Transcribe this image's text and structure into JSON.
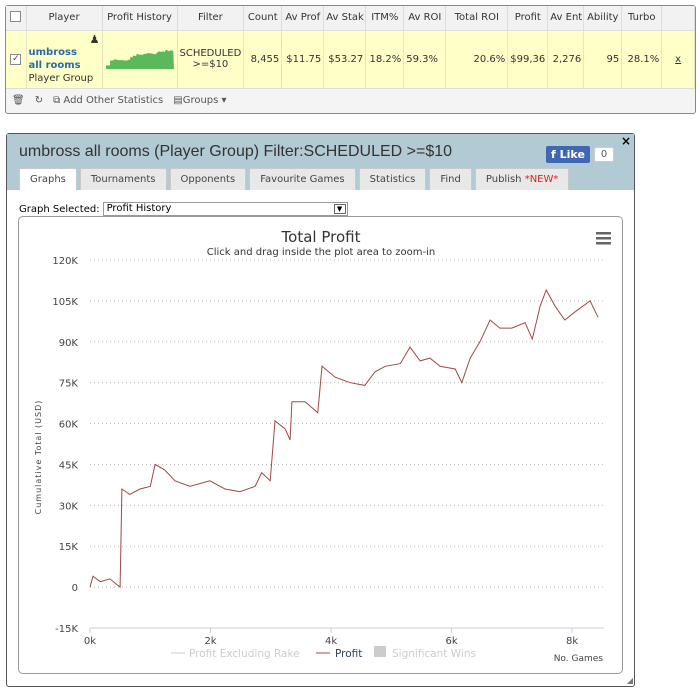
{
  "table": {
    "headers": [
      "Player",
      "Profit History",
      "Filter",
      "Count",
      "Av Prof",
      "Av Stak",
      "ITM%",
      "Av ROI",
      "Total ROI",
      "Profit",
      "Av Ent",
      "Ability",
      "Turbo"
    ],
    "row": {
      "checked": true,
      "player_name": "umbross all rooms",
      "player_sub": "Player Group",
      "filter": "SCHEDULED >=$10",
      "count": "8,455",
      "av_profit": "$11.75",
      "av_stake": "$53.27",
      "itm": "18.2%",
      "av_roi": "59.3%",
      "total_roi": "20.6%",
      "profit": "$99,36",
      "av_entrants": "2,276",
      "ability": "95",
      "turbo": "28.1%",
      "remove": "x"
    },
    "footer": {
      "add_stats": "Add Other Statistics",
      "groups": "Groups"
    }
  },
  "panel": {
    "title": "umbross all rooms (Player Group) Filter:SCHEDULED >=$10",
    "like_label": "Like",
    "like_count": "0",
    "close": "×",
    "tabs": [
      {
        "label": "Graphs",
        "active": true
      },
      {
        "label": "Tournaments"
      },
      {
        "label": "Opponents"
      },
      {
        "label": "Favourite Games"
      },
      {
        "label": "Statistics"
      },
      {
        "label": "Find"
      },
      {
        "label": "Publish ",
        "badge": "*NEW*"
      }
    ],
    "graph_selected_label": "Graph Selected:",
    "graph_selected_value": "Profit History"
  },
  "chart_data": {
    "type": "line",
    "title": "Total Profit",
    "subtitle": "Click and drag inside the plot area to zoom-in",
    "xlabel": "No. Games",
    "ylabel": "Cumulative Total (USD)",
    "xlim": [
      0,
      8530
    ],
    "ylim": [
      -15000,
      120000
    ],
    "xticks": [
      {
        "v": 0,
        "label": "0k"
      },
      {
        "v": 2000,
        "label": "2k"
      },
      {
        "v": 4000,
        "label": "4k"
      },
      {
        "v": 6000,
        "label": "6k"
      },
      {
        "v": 8000,
        "label": "8k"
      }
    ],
    "yticks": [
      {
        "v": -15000,
        "label": "-15K"
      },
      {
        "v": 0,
        "label": "0"
      },
      {
        "v": 15000,
        "label": "15K"
      },
      {
        "v": 30000,
        "label": "30K"
      },
      {
        "v": 45000,
        "label": "45K"
      },
      {
        "v": 60000,
        "label": "60K"
      },
      {
        "v": 75000,
        "label": "75K"
      },
      {
        "v": 90000,
        "label": "90K"
      },
      {
        "v": 105000,
        "label": "105K"
      },
      {
        "v": 120000,
        "label": "120K"
      }
    ],
    "grid": true,
    "legend": {
      "placement": "bottom",
      "items": [
        {
          "label": "Profit Excluding Rake",
          "color": "#cccccc",
          "hidden": true
        },
        {
          "label": "Profit",
          "color": "#a04848"
        },
        {
          "label": "Significant Wins",
          "color": "#cccccc",
          "hidden": true,
          "type": "box"
        }
      ]
    },
    "series": [
      {
        "name": "Profit",
        "color": "#a04848",
        "x": [
          0,
          50,
          170,
          330,
          500,
          530,
          660,
          830,
          1000,
          1080,
          1240,
          1410,
          1660,
          1990,
          2240,
          2490,
          2740,
          2850,
          2990,
          3070,
          3240,
          3320,
          3350,
          3570,
          3780,
          3850,
          4070,
          4320,
          4560,
          4730,
          4900,
          5150,
          5310,
          5480,
          5640,
          5810,
          6060,
          6170,
          6310,
          6470,
          6640,
          6800,
          7000,
          7220,
          7340,
          7470,
          7570,
          7720,
          7880,
          8050,
          8300,
          8430
        ],
        "y": [
          0,
          4000,
          2000,
          3000,
          0,
          36000,
          34000,
          36000,
          37000,
          45000,
          43000,
          39000,
          37000,
          39000,
          36000,
          35000,
          37000,
          42000,
          39000,
          61000,
          58000,
          54000,
          68000,
          68000,
          64000,
          81000,
          77000,
          75000,
          74000,
          79000,
          81000,
          82000,
          88000,
          83000,
          84000,
          81000,
          80000,
          75000,
          84000,
          90000,
          98000,
          95000,
          95000,
          97000,
          91000,
          103000,
          109000,
          103000,
          98000,
          101000,
          105000,
          99000
        ]
      }
    ]
  },
  "colors": {
    "row_highlight": "#ffffc8",
    "header_bg": "#b2cad3",
    "sparkline": "#5cb85c",
    "facebook": "#4267b2"
  }
}
